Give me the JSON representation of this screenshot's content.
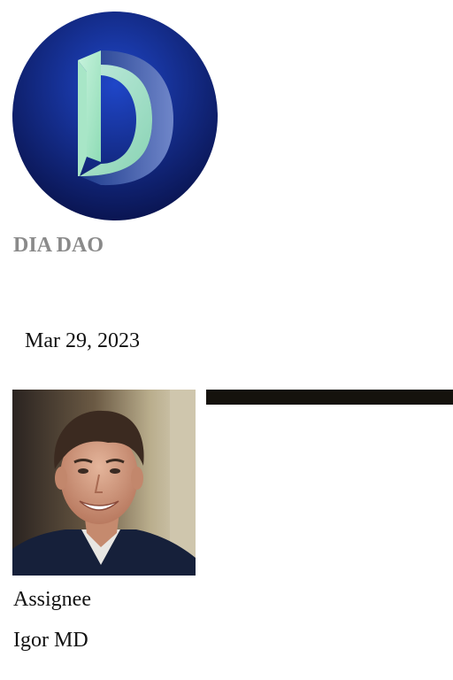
{
  "org": {
    "name": "DIA DAO",
    "logo_icon": "dia-dao-logo-icon",
    "logo_colors": {
      "background_top": "#1a3fbe",
      "background_bottom": "#0b1654",
      "letter_light": "#b6ecd2",
      "letter_dark": "#2a4a9a"
    }
  },
  "item": {
    "date": "Mar 29, 2023"
  },
  "assignee": {
    "label": "Assignee",
    "name": "Igor MD",
    "avatar_icon": "user-avatar-photo"
  }
}
